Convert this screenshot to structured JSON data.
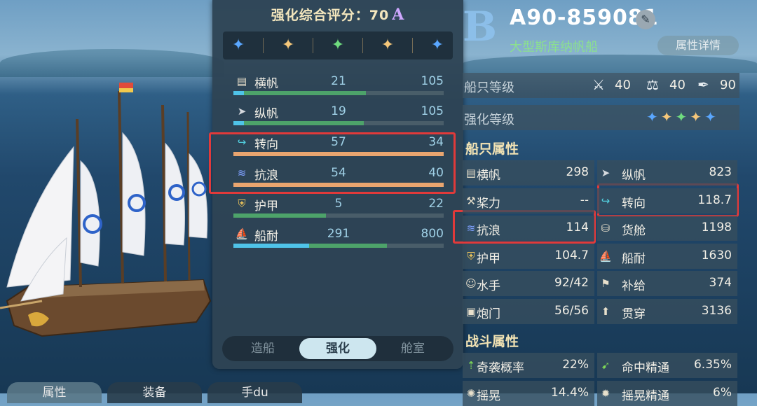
{
  "panel": {
    "title": "强化综合评分：70",
    "grade": "A",
    "stars": [
      "#5aa7ff",
      "#f5c77a",
      "#6fdc7f",
      "#f5c77a",
      "#5aa7ff"
    ],
    "stats": [
      {
        "icon": "sail-icon",
        "name": "横帆",
        "v1": "21",
        "v2": "105",
        "pa": 0.05,
        "pb": 0.63,
        "orange": false
      },
      {
        "icon": "paper-plane-icon",
        "name": "纵帆",
        "v1": "19",
        "v2": "105",
        "pa": 0.05,
        "pb": 0.62,
        "orange": false
      },
      {
        "icon": "turn-arrow-icon",
        "name": "转向",
        "v1": "57",
        "v2": "34",
        "pa": 1.0,
        "pb": 1.0,
        "orange": true
      },
      {
        "icon": "wave-icon",
        "name": "抗浪",
        "v1": "54",
        "v2": "40",
        "pa": 1.0,
        "pb": 1.0,
        "orange": true
      },
      {
        "icon": "armor-icon",
        "name": "护甲",
        "v1": "5",
        "v2": "22",
        "pa": 0.0,
        "pb": 0.44,
        "orange": false
      },
      {
        "icon": "hull-icon",
        "name": "船耐",
        "v1": "291",
        "v2": "800",
        "pa": 0.36,
        "pb": 0.73,
        "orange": false
      }
    ],
    "tabs": [
      "造船",
      "强化",
      "舱室"
    ],
    "active_tab": 1
  },
  "ship": {
    "grade_letter": "B",
    "id": "A90-859081",
    "type": "大型斯库纳帆船",
    "details_button": "属性详情",
    "level_label": "船只等级",
    "levels": [
      {
        "icon": "swords-icon",
        "value": "40"
      },
      {
        "icon": "scale-icon",
        "value": "40"
      },
      {
        "icon": "quill-icon",
        "value": "90"
      }
    ],
    "enhance_label": "强化等级",
    "enhance_stars": [
      "#5aa7ff",
      "#f5c77a",
      "#6fdc7f",
      "#f5c77a",
      "#5aa7ff"
    ]
  },
  "ship_attrs_title": "船只属性",
  "ship_attrs": [
    {
      "name": "横帆",
      "value": "298",
      "icon": "sail-icon"
    },
    {
      "name": "纵帆",
      "value": "823",
      "icon": "paper-plane-icon"
    },
    {
      "name": "桨力",
      "value": "--",
      "icon": "oar-icon"
    },
    {
      "name": "转向",
      "value": "118.7",
      "icon": "turn-arrow-icon"
    },
    {
      "name": "抗浪",
      "value": "114",
      "icon": "wave-icon"
    },
    {
      "name": "货舱",
      "value": "1198",
      "icon": "barrel-icon"
    },
    {
      "name": "护甲",
      "value": "104.7",
      "icon": "armor-icon"
    },
    {
      "name": "船耐",
      "value": "1630",
      "icon": "hull-icon"
    },
    {
      "name": "水手",
      "value": "92/42",
      "icon": "sailor-icon"
    },
    {
      "name": "补给",
      "value": "374",
      "icon": "supply-icon"
    },
    {
      "name": "炮门",
      "value": "56/56",
      "icon": "cannon-port-icon"
    },
    {
      "name": "贯穿",
      "value": "3136",
      "icon": "pierce-icon"
    }
  ],
  "combat_title": "战斗属性",
  "combat_attrs": [
    {
      "name": "奇袭概率",
      "value": "22%",
      "icon": "ambush-icon"
    },
    {
      "name": "命中精通",
      "value": "6.35%",
      "icon": "cannon-icon"
    },
    {
      "name": "摇晃",
      "value": "14.4%",
      "icon": "shake-icon"
    },
    {
      "name": "摇晃精通",
      "value": "6%",
      "icon": "shake-mastery-icon"
    }
  ],
  "bottom_tabs": [
    "属性",
    "装备",
    "手du"
  ]
}
